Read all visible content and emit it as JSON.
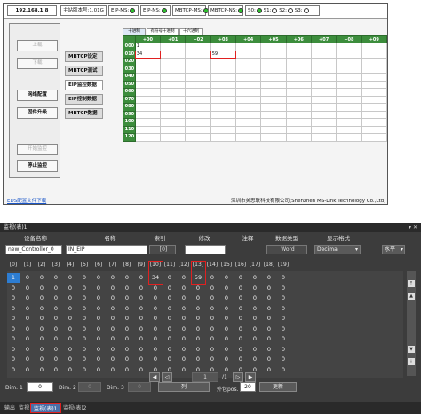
{
  "top": {
    "ip": "192.168.1.8",
    "fw": "主站版本号:1.01G",
    "eip_ms": "EIP-MS:",
    "eip_ns": "EIP-NS:",
    "mbtcp_ms": "MBTCP-MS:",
    "mbtcp_ns": "MBTCP-NS:",
    "s0": "S0:",
    "s1": "S1:",
    "s2": "S2:",
    "s3": "S3:",
    "buttons": {
      "upload": "上载",
      "download": "下载",
      "netcfg": "网络配置",
      "fwup": "固件升级",
      "startmon": "开始监控",
      "stopmon": "停止监控"
    },
    "tabs": [
      "MBTCP设定",
      "MBTCP测试",
      "EIP监控数据",
      "EIP控制数据",
      "MBTCP数据"
    ],
    "subtabs": [
      "十进制",
      "有符号十进制",
      "十六进制"
    ],
    "colheads": [
      "+00",
      "+01",
      "+02",
      "+03",
      "+04",
      "+05",
      "+06",
      "+07",
      "+08",
      "+09"
    ],
    "rows": [
      "000",
      "010",
      "020",
      "030",
      "040",
      "050",
      "060",
      "070",
      "080",
      "090",
      "100",
      "110",
      "120"
    ],
    "row000": [
      "1",
      "",
      "",
      "",
      "",
      "",
      "",
      "",
      "",
      ""
    ],
    "row010": [
      "34",
      "",
      "",
      "59",
      "",
      "",
      "",
      "",
      "",
      ""
    ],
    "eds": "EDS配置文件下载",
    "company": "深圳市美思联科技有限公司(Shenzhen MS-Link Technology Co.,Ltd)"
  },
  "bottom": {
    "title": "监视(表)1",
    "ctrl": "▾ ✕",
    "hdr": {
      "device": "设备名称",
      "name": "名称",
      "index": "索引",
      "modify": "修改",
      "comment": "注释",
      "dtype": "数据类型",
      "dformat": "显示格式"
    },
    "device": "new_Controller_0",
    "name": "IN_EIP",
    "index": "[0]",
    "dtype": "Word",
    "dformat": "Decimal",
    "orient": "水平",
    "col_idx": [
      "[0]",
      "[1]",
      "[2]",
      "[3]",
      "[4]",
      "[5]",
      "[6]",
      "[7]",
      "[8]",
      "[9]",
      "[10]",
      "[11]",
      "[12]",
      "[13]",
      "[14]",
      "[15]",
      "[16]",
      "[17]",
      "[18]",
      "[19]"
    ],
    "row1": [
      "1",
      "0",
      "0",
      "0",
      "0",
      "0",
      "0",
      "0",
      "0",
      "0",
      "34",
      "0",
      "0",
      "59",
      "0",
      "0",
      "0",
      "0",
      "0",
      "0"
    ],
    "page": "1",
    "page_total": "/1",
    "dim1_label": "Dim. 1",
    "dim1": "0",
    "dim2_label": "Dim. 2",
    "dim2": "0",
    "dim3_label": "Dim. 3",
    "dim3": "0",
    "col_btn": "列",
    "outpos_label": "外包pos.",
    "outpos": "20",
    "update_btn": "更新",
    "tabs": [
      "输出",
      "监视",
      "监视(表)1",
      "监视(表)2"
    ]
  },
  "colors": {
    "green": "#3c8d3c",
    "red": "#e02020",
    "select": "#2d7dd2"
  }
}
